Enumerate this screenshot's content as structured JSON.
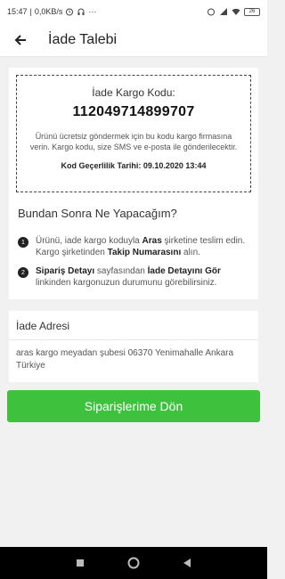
{
  "status_bar": {
    "time": "15:47",
    "network_speed": "0,0KB/s",
    "more": "···",
    "battery": "26"
  },
  "header": {
    "title": "İade Talebi",
    "back_icon": "arrow-left-icon"
  },
  "return_code": {
    "label": "İade Kargo Kodu:",
    "value": "112049714899707",
    "description": "Ürünü ücretsiz göndermek için bu kodu kargo firmasına verin. Kargo kodu, size SMS ve e-posta ile gönderilecektir.",
    "validity": "Kod Geçerlilik Tarihi: 09.10.2020 13:44"
  },
  "next_steps": {
    "title": "Bundan Sonra Ne Yapacağım?",
    "steps": [
      {
        "number": "1",
        "pre": "Ürünü, iade kargo koduyla ",
        "b1": "Aras",
        "mid": " şirketine teslim edin. Kargo şirketinden ",
        "b2": "Takip Numarasını",
        "post": " alın."
      },
      {
        "number": "2",
        "b1": "Sipariş Detayı",
        "mid": " sayfasından ",
        "b2": "İade Detayını Gör",
        "post": " linkinden kargonuzun durumunu görebilirsiniz."
      }
    ]
  },
  "address": {
    "title": "İade Adresi",
    "text": "aras kargo meyadan şubesi 06370 Yenimahalle Ankara Türkiye"
  },
  "cta": {
    "label": "Siparişlerime Dön"
  },
  "colors": {
    "accent": "#3ec23e",
    "background": "#f1f1f1"
  }
}
